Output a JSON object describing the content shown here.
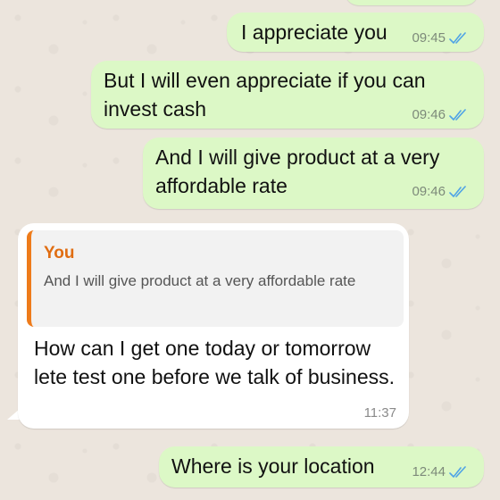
{
  "messages": [
    {
      "text": "I appreciate you",
      "time": "09:45"
    },
    {
      "text": "But I will even appreciate if you can invest cash",
      "time": "09:46"
    },
    {
      "text": "And I will give product at a very affordable rate",
      "time": "09:46"
    },
    {
      "quote_author": "You",
      "quote_text": "And I will give product at a very affordable rate",
      "text": "How can I get one today or tomorrow lete test one before we talk of business.",
      "time": "11:37"
    },
    {
      "text": "Where is your location",
      "time": "12:44"
    }
  ],
  "colors": {
    "outgoing_bubble": "#dcf8c6",
    "incoming_bubble": "#ffffff",
    "read_ticks": "#4fa3e6",
    "quote_accent": "#ee7b1a",
    "chat_background": "#ece5dd"
  },
  "icons": {
    "read_receipt": "double-check-icon"
  }
}
